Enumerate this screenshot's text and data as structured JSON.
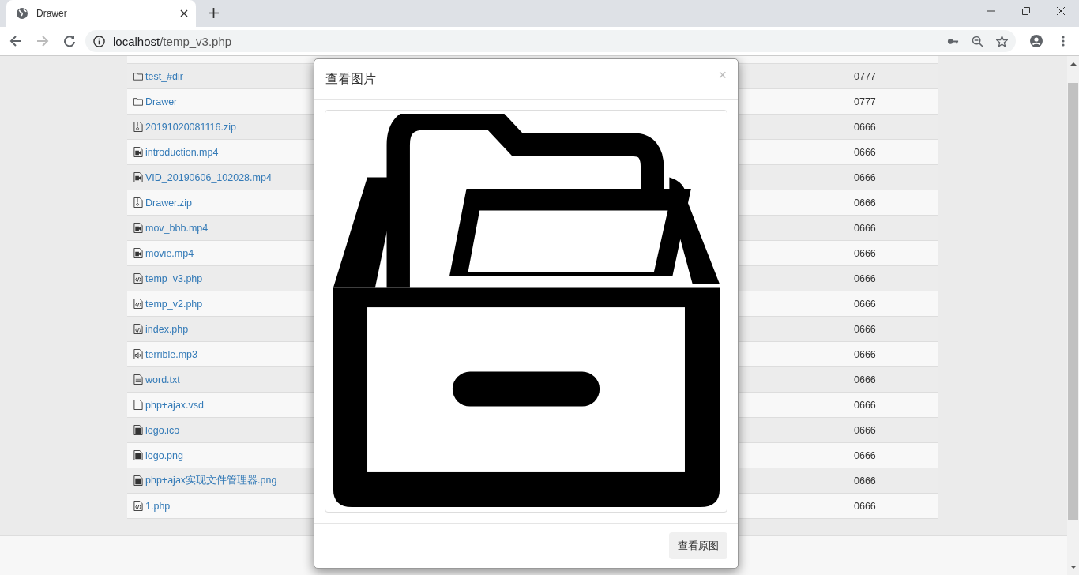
{
  "browser": {
    "tab_title": "Drawer",
    "url_host": "localhost",
    "url_path": "/temp_v3.php"
  },
  "files": [
    {
      "name": "test_#dir",
      "kind": "folder",
      "mode": "0777"
    },
    {
      "name": "Drawer",
      "kind": "folder",
      "mode": "0777"
    },
    {
      "name": "20191020081116.zip",
      "kind": "zip",
      "mode": "0666"
    },
    {
      "name": "introduction.mp4",
      "kind": "video",
      "mode": "0666"
    },
    {
      "name": "VID_20190606_102028.mp4",
      "kind": "video",
      "mode": "0666"
    },
    {
      "name": "Drawer.zip",
      "kind": "zip",
      "mode": "0666"
    },
    {
      "name": "mov_bbb.mp4",
      "kind": "video",
      "mode": "0666"
    },
    {
      "name": "movie.mp4",
      "kind": "video",
      "mode": "0666"
    },
    {
      "name": "temp_v3.php",
      "kind": "code",
      "mode": "0666"
    },
    {
      "name": "temp_v2.php",
      "kind": "code",
      "mode": "0666"
    },
    {
      "name": "index.php",
      "kind": "code",
      "mode": "0666"
    },
    {
      "name": "terrible.mp3",
      "kind": "audio",
      "mode": "0666"
    },
    {
      "name": "word.txt",
      "kind": "text",
      "mode": "0666"
    },
    {
      "name": "php+ajax.vsd",
      "kind": "blank",
      "mode": "0666"
    },
    {
      "name": "logo.ico",
      "kind": "image",
      "mode": "0666"
    },
    {
      "name": "logo.png",
      "kind": "image",
      "mode": "0666"
    },
    {
      "name": "php+ajax实现文件管理器.png",
      "kind": "image",
      "mode": "0666"
    },
    {
      "name": "1.php",
      "kind": "code",
      "mode": "0666"
    }
  ],
  "modal": {
    "title": "查看图片",
    "close": "×",
    "button": "查看原图"
  }
}
